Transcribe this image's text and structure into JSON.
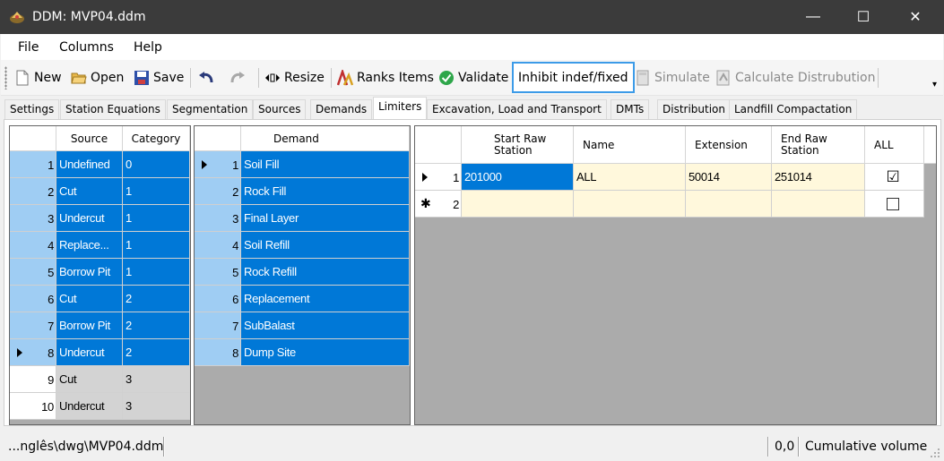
{
  "window": {
    "title": "DDM: MVP04.ddm",
    "minimize_glyph": "—",
    "maximize_glyph": "☐",
    "close_glyph": "✕"
  },
  "menu": {
    "items": [
      {
        "label": "File"
      },
      {
        "label": "Columns"
      },
      {
        "label": "Help"
      }
    ]
  },
  "toolbar": {
    "new_label": "New",
    "open_label": "Open",
    "save_label": "Save",
    "resize_label": "Resize",
    "ranks_label": "Ranks Items",
    "validate_label": "Validate",
    "inhibit_label": "Inhibit indef/fixed",
    "simulate_label": "Simulate",
    "calculate_label": "Calculate Distrubution",
    "overflow_glyph": "▾"
  },
  "tabs": [
    {
      "label": "Settings"
    },
    {
      "label": "Station Equations"
    },
    {
      "label": "Segmentation"
    },
    {
      "label": "Sources"
    },
    {
      "label": "Demands"
    },
    {
      "label": "Limiters",
      "active": true
    },
    {
      "label": "Excavation, Load and Transport"
    },
    {
      "label": "DMTs"
    },
    {
      "label": "Distribution"
    },
    {
      "label": "Landfill Compactation"
    }
  ],
  "sources_grid": {
    "headers": {
      "source": "Source",
      "category": "Category"
    },
    "rows": [
      {
        "n": "1",
        "source": "Undefined",
        "category": "0"
      },
      {
        "n": "2",
        "source": "Cut",
        "category": "1"
      },
      {
        "n": "3",
        "source": "Undercut",
        "category": "1"
      },
      {
        "n": "4",
        "source": "Replace...",
        "category": "1"
      },
      {
        "n": "5",
        "source": "Borrow Pit",
        "category": "1"
      },
      {
        "n": "6",
        "source": "Cut",
        "category": "2"
      },
      {
        "n": "7",
        "source": "Borrow Pit",
        "category": "2"
      },
      {
        "n": "8",
        "source": "Undercut",
        "category": "2"
      },
      {
        "n": "9",
        "source": "Cut",
        "category": "3"
      },
      {
        "n": "10",
        "source": "Undercut",
        "category": "3"
      }
    ]
  },
  "demands_grid": {
    "headers": {
      "demand": "Demand"
    },
    "rows": [
      {
        "n": "1",
        "demand": "Soil Fill"
      },
      {
        "n": "2",
        "demand": "Rock Fill"
      },
      {
        "n": "3",
        "demand": "Final Layer"
      },
      {
        "n": "4",
        "demand": "Soil Refill"
      },
      {
        "n": "5",
        "demand": "Rock Refill"
      },
      {
        "n": "6",
        "demand": "Replacement"
      },
      {
        "n": "7",
        "demand": "SubBalast"
      },
      {
        "n": "8",
        "demand": "Dump Site"
      }
    ]
  },
  "limiters_grid": {
    "headers": {
      "start_line1": "Start Raw",
      "start_line2": "Station",
      "name": "Name",
      "extension": "Extension",
      "end_line1": "End Raw",
      "end_line2": "Station",
      "all": "ALL"
    },
    "rows": [
      {
        "n": "1",
        "start": "201000",
        "name": "ALL",
        "extension": "50014",
        "end": "251014",
        "all": "☑"
      },
      {
        "n": "2",
        "start": "",
        "name": "",
        "extension": "",
        "end": "",
        "all": ""
      }
    ],
    "new_row_glyph": "✱"
  },
  "status": {
    "path": "...nglês\\dwg\\MVP04.ddm",
    "coords": "0,0",
    "mode": "Cumulative volume"
  }
}
